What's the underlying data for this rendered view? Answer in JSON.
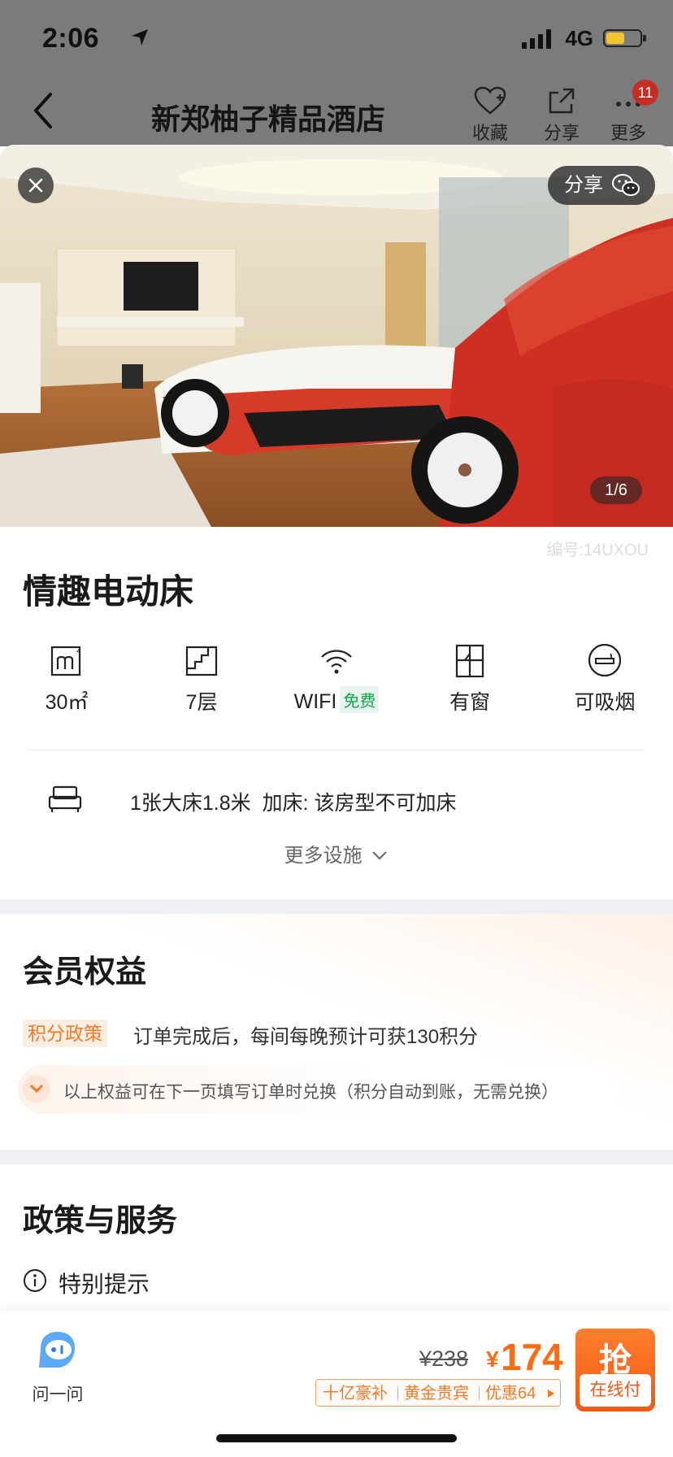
{
  "status_bar": {
    "time": "2:06",
    "network": "4G"
  },
  "nav": {
    "title": "新郑柚子精品酒店",
    "favorite_label": "收藏",
    "share_label": "分享",
    "more_label": "更多",
    "more_badge": "11"
  },
  "gallery": {
    "share_label": "分享",
    "counter": "1/6",
    "room_code": "编号:14UXOU"
  },
  "room": {
    "name": "情趣电动床",
    "facilities": [
      {
        "icon": "area-icon",
        "label": "30㎡"
      },
      {
        "icon": "floor-icon",
        "label": "7层"
      },
      {
        "icon": "wifi-icon",
        "label": "WIFI",
        "tag": "免费"
      },
      {
        "icon": "window-icon",
        "label": "有窗"
      },
      {
        "icon": "smoking-icon",
        "label": "可吸烟"
      }
    ],
    "bed_info": "1张大床1.8米  加床: 该房型不可加床",
    "more_facilities": "更多设施"
  },
  "member": {
    "heading": "会员权益",
    "points_tag": "积分政策",
    "points_text": "订单完成后，每间每晚预计可获130积分",
    "tip": "以上权益可在下一页填写订单时兑换（积分自动到账，无需兑换）"
  },
  "policy": {
    "heading": "政策与服务",
    "notice": "特别提示"
  },
  "bottom_bar": {
    "ask_label": "问一问",
    "original_price": "¥238",
    "currency": "¥",
    "price": "174",
    "promo_1": "十亿豪补",
    "promo_2": "黄金贵宾",
    "promo_3": "优惠64",
    "buy_label": "抢",
    "pay_label": "在线付"
  },
  "colors": {
    "accent": "#ff6a13",
    "free_green": "#16a34a",
    "badge_red": "#c62d23"
  }
}
